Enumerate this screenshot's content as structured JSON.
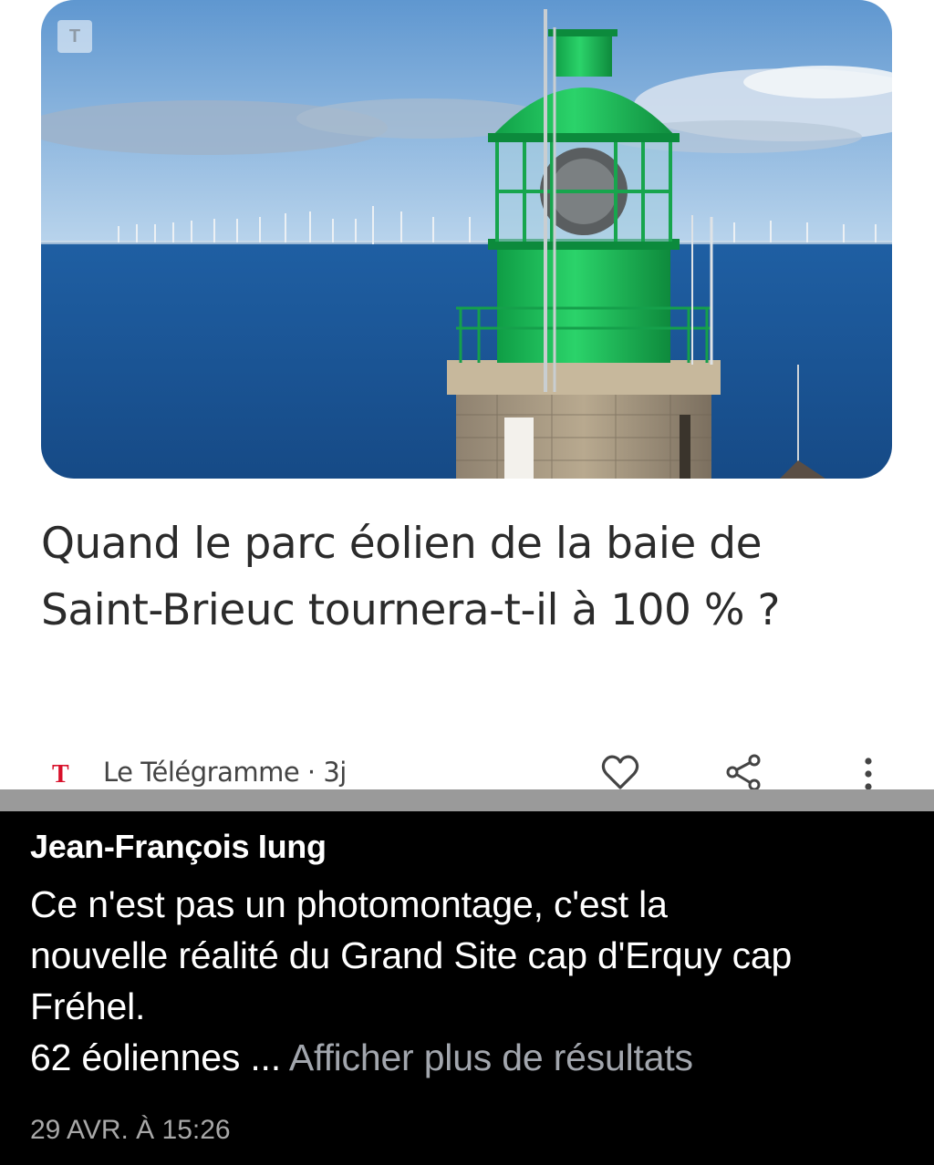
{
  "article": {
    "source_badge": "T",
    "image_icon": "lighthouse-photo",
    "headline": "Quand le parc éolien de la baie de Saint-Brieuc tournera-t-il à 100 % ?",
    "publisher_logo": "T",
    "publisher_name": "Le Télégramme",
    "age": "3j",
    "actions": [
      "heart-icon",
      "share-icon",
      "more-vert-icon"
    ]
  },
  "post": {
    "author": "Jean-François Iung",
    "text_line_1": "Ce n'est pas un photomontage, c'est la",
    "text_line_2": "nouvelle réalité du Grand Site cap d'Erquy cap",
    "text_line_3": "Fréhel.",
    "text_line_4_start": "62 éoliennes ...",
    "more_link": "Afficher plus de résultats",
    "timestamp": "29 AVR. À 15:26"
  },
  "colors": {
    "publisher_red": "#d8102a",
    "lighthouse_green": "#1fbf5a",
    "sea_blue": "#1a5596",
    "overlay_bg": "#000000",
    "link_grey": "#a2a6ad"
  }
}
